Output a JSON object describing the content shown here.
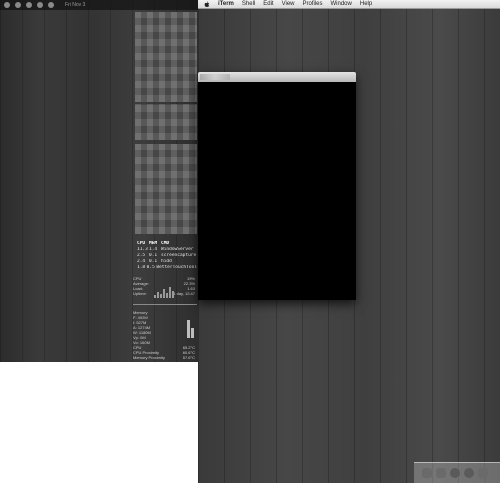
{
  "left_screen": {
    "status_bar": {
      "clock": "Fri Nov 3"
    },
    "process_table": {
      "headers": [
        "CPU",
        "MEM",
        "CMD"
      ],
      "rows": [
        [
          "11.3",
          "1.4",
          "WindowServer"
        ],
        [
          "2.5",
          "0.1",
          "screencapture"
        ],
        [
          "2.4",
          "0.1",
          "hidd"
        ],
        [
          "1.8",
          "0.5",
          "BetterTouchTool"
        ]
      ]
    },
    "cpu_widget": {
      "rows": [
        {
          "label": "CPU",
          "value": "19%"
        },
        {
          "label": "Average:",
          "value": "22.3%"
        },
        {
          "label": "Load:",
          "value": "1.63"
        },
        {
          "label": "Uptime:",
          "value": "1 day, 12:47"
        }
      ]
    },
    "memory_widget": {
      "lines": [
        "Memory",
        "F: 492M",
        "I: 527M",
        "A: 1274M",
        "W: 1180M",
        "Vp: 0M",
        "Vo: 160M",
        "CPU",
        "CPU Proximity",
        "Memory Proximity"
      ],
      "values": [
        "65.2°C",
        "60.6°C",
        "57.6°C"
      ]
    }
  },
  "menubar": {
    "app_name": "iTerm",
    "items": [
      "Shell",
      "Edit",
      "View",
      "Profiles",
      "Window",
      "Help"
    ]
  },
  "dock": {
    "icons": [
      "finder-icon",
      "app-icon",
      "clock-icon",
      "gear-icon",
      "trash-icon"
    ]
  }
}
